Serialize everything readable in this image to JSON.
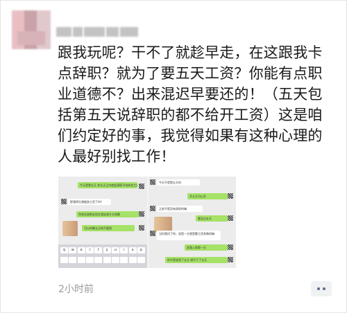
{
  "post": {
    "text": "跟我玩呢？干不了就趁早走，在这跟我卡点辞职？就为了要五天工资？你能有点职业道德不？出来混迟早要还的！（五天包括第五天说辞职的都不给开工资）这是咱们约定好的事，我觉得如果有这种心理的人最好别找工作！",
    "timestamp": "2小时前",
    "more_icon": "more-dots-icon"
  },
  "image": {
    "left_chat": [
      {
        "side": "green",
        "text": "今天是第五天 你五天之内就会离职不给你发工资"
      },
      {
        "side": "white",
        "text": "那我明天就能辞工资了吗？"
      },
      {
        "side": "green",
        "text": "你现在辞职这话在我这里什么用都"
      },
      {
        "side": "green",
        "text": "可以的算五天的不要钱"
      }
    ],
    "right_chat": [
      {
        "side": "white",
        "text": "今天不是第五天吗"
      },
      {
        "side": "green",
        "text": "开五天可以开"
      },
      {
        "side": "white",
        "text": "之前不是没有辞职的嘛"
      },
      {
        "side": "green",
        "text": "看见过五天"
      },
      {
        "side": "white",
        "text": "当时我问了你，说是一天就是算工资多做的嘛"
      },
      {
        "side": "green",
        "text": "说我入职第一天"
      },
      {
        "side": "green",
        "text": "你不是说到了五天 就不干了五天"
      }
    ],
    "keyboard_keys": [
      "q",
      "w",
      "e",
      "r",
      "t",
      "y",
      "u",
      "i",
      "o",
      "p"
    ]
  }
}
